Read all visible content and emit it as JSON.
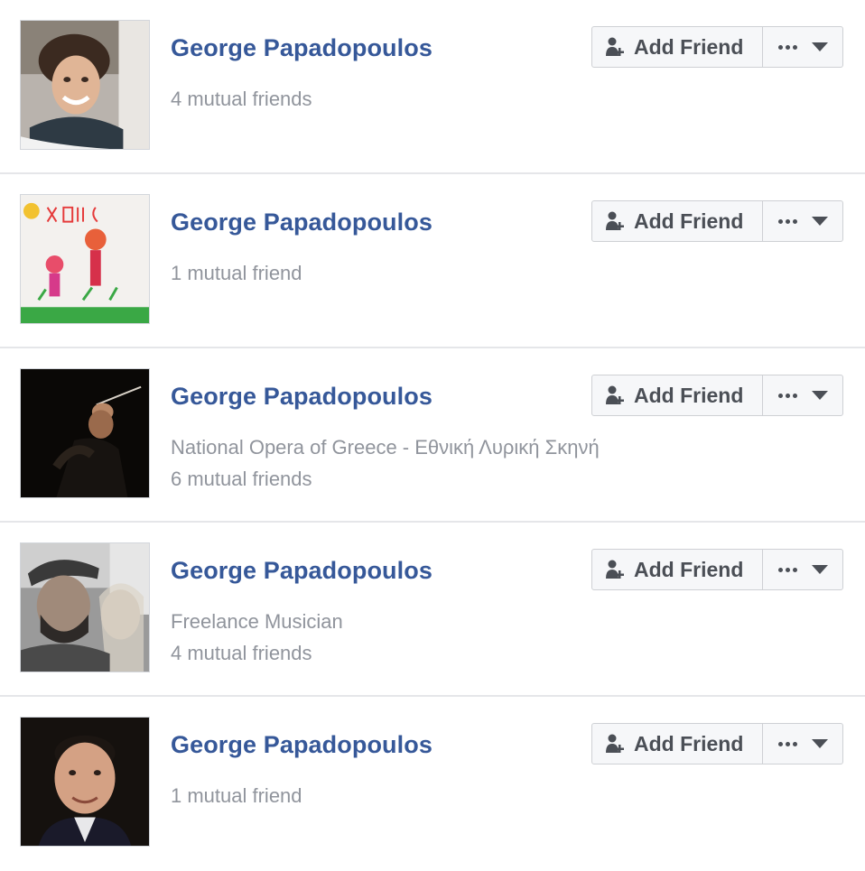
{
  "colors": {
    "name_link": "#365899",
    "meta_text": "#90949c",
    "button_text": "#4b4f56",
    "button_bg": "#f6f7f9",
    "divider": "#e5e6e9"
  },
  "results": [
    {
      "name": "George Papadopoulos",
      "meta": [
        "4 mutual friends"
      ],
      "add_label": "Add Friend",
      "avatar_icon": "profile-photo-young-man-scarf"
    },
    {
      "name": "George Papadopoulos",
      "meta": [
        "1 mutual friend"
      ],
      "add_label": "Add Friend",
      "avatar_icon": "profile-photo-child-drawing"
    },
    {
      "name": "George Papadopoulos",
      "meta": [
        "National Opera of Greece - Εθνική Λυρική Σκηνή",
        "6 mutual friends"
      ],
      "add_label": "Add Friend",
      "avatar_icon": "profile-photo-conductor"
    },
    {
      "name": "George Papadopoulos",
      "meta": [
        "Freelance Musician",
        "4 mutual friends"
      ],
      "add_label": "Add Friend",
      "avatar_icon": "profile-photo-couple-selfie"
    },
    {
      "name": "George Papadopoulos",
      "meta": [
        "1 mutual friend"
      ],
      "add_label": "Add Friend",
      "avatar_icon": "profile-photo-man-portrait"
    }
  ]
}
